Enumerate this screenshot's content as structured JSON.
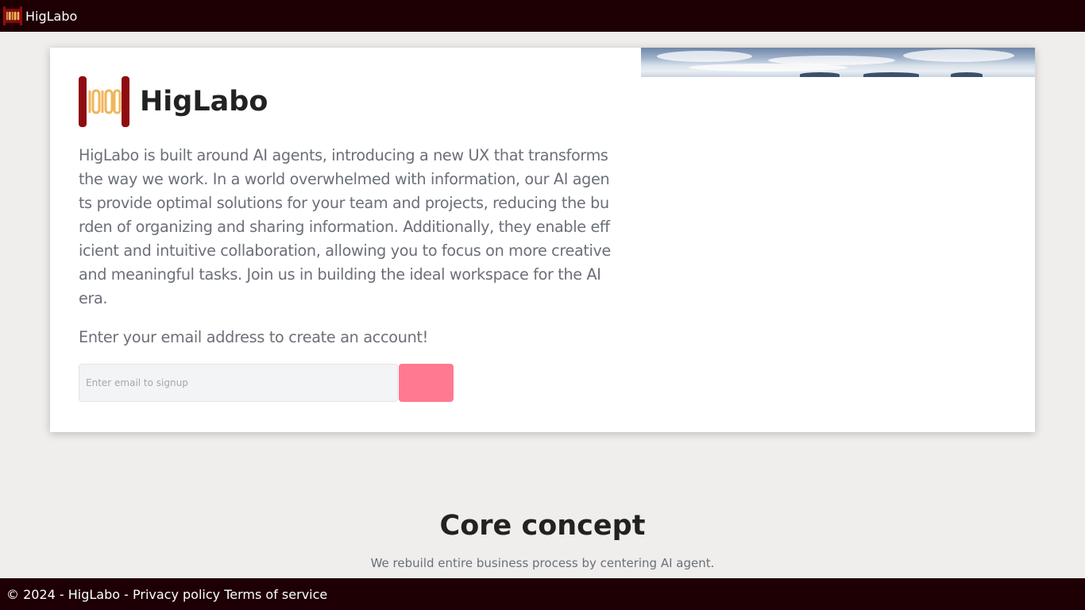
{
  "header": {
    "brand": "HigLabo",
    "logo_icon": "higlabo-logo-icon"
  },
  "hero": {
    "title": "HigLabo",
    "description": "HigLabo is built around AI agents, introducing a new UX that transforms the way we work. In a world overwhelmed with information, our AI agents provide optimal solutions for your team and projects, reducing the burden of organizing and sharing information. Additionally, they enable efficient and intuitive collaboration, allowing you to focus on more creative and meaningful tasks. Join us in building the ideal workspace for the AI era.",
    "signup_prompt": "Enter your email address to create an account!",
    "email_placeholder": "Enter email to signup",
    "email_value": "",
    "signup_button_color": "#ff7a90"
  },
  "concept": {
    "heading": "Core concept",
    "subheading": "We rebuild entire business process by centering AI agent."
  },
  "footer": {
    "copyright": "© 2024 - HigLabo -",
    "privacy_label": "Privacy policy",
    "terms_label": "Terms of service"
  },
  "colors": {
    "bar_background": "#1e0004",
    "page_background": "#efeeec",
    "logo_red": "#8f0d10",
    "logo_gold": "#f0b55a"
  }
}
